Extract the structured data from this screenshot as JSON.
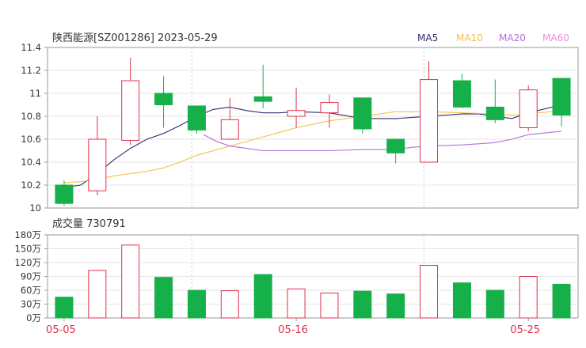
{
  "chart_data": [
    {
      "type": "candlestick",
      "title": "陕西能源[SZ001286] 2023-05-29",
      "legend": [
        {
          "label": "MA5",
          "color": "#2e2e6e"
        },
        {
          "label": "MA10",
          "color": "#f5c04a"
        },
        {
          "label": "MA20",
          "color": "#b070d8"
        },
        {
          "label": "MA60",
          "color": "#e890d8"
        }
      ],
      "y_ticks": [
        "11.4",
        "11.2",
        "11",
        "10.8",
        "10.6",
        "10.4",
        "10.2",
        "10"
      ],
      "ylim": [
        10.0,
        11.4
      ],
      "x_ticks": [
        {
          "index": 0,
          "label": "05-05"
        },
        {
          "index": 7,
          "label": "05-16"
        },
        {
          "index": 14,
          "label": "05-25"
        }
      ],
      "candles": [
        {
          "o": 10.2,
          "h": 10.24,
          "l": 10.02,
          "c": 10.04
        },
        {
          "o": 10.15,
          "h": 10.8,
          "l": 10.11,
          "c": 10.6
        },
        {
          "o": 10.59,
          "h": 11.31,
          "l": 10.55,
          "c": 11.11
        },
        {
          "o": 11.0,
          "h": 11.15,
          "l": 10.7,
          "c": 10.9
        },
        {
          "o": 10.89,
          "h": 10.89,
          "l": 10.65,
          "c": 10.68
        },
        {
          "o": 10.6,
          "h": 10.96,
          "l": 10.6,
          "c": 10.77
        },
        {
          "o": 10.97,
          "h": 11.25,
          "l": 10.87,
          "c": 10.93
        },
        {
          "o": 10.8,
          "h": 11.05,
          "l": 10.7,
          "c": 10.85
        },
        {
          "o": 10.83,
          "h": 10.99,
          "l": 10.7,
          "c": 10.92
        },
        {
          "o": 10.96,
          "h": 10.96,
          "l": 10.65,
          "c": 10.69
        },
        {
          "o": 10.6,
          "h": 10.6,
          "l": 10.39,
          "c": 10.48
        },
        {
          "o": 10.4,
          "h": 11.28,
          "l": 10.4,
          "c": 11.12
        },
        {
          "o": 11.11,
          "h": 11.17,
          "l": 10.87,
          "c": 10.88
        },
        {
          "o": 10.88,
          "h": 11.12,
          "l": 10.74,
          "c": 10.77
        },
        {
          "o": 10.7,
          "h": 11.07,
          "l": 10.67,
          "c": 11.03
        },
        {
          "o": 11.13,
          "h": 11.13,
          "l": 10.71,
          "c": 10.81
        }
      ],
      "ma_lines": {
        "MA5": [
          10.18,
          10.2,
          10.3,
          10.42,
          10.52,
          10.6,
          10.65,
          10.72,
          10.8,
          10.86,
          10.88,
          10.85,
          10.83,
          10.83,
          10.84,
          10.83,
          10.78,
          10.78,
          10.8,
          10.82,
          10.82,
          10.8,
          10.78,
          10.83,
          10.9,
          10.92
        ],
        "MA10": [
          10.22,
          10.23,
          10.25,
          10.28,
          10.3,
          10.32,
          10.35,
          10.4,
          10.46,
          10.5,
          10.54,
          10.58,
          10.62,
          10.66,
          10.7,
          10.73,
          10.76,
          10.8,
          10.84,
          10.84,
          10.83,
          10.82,
          10.81,
          10.82,
          10.85,
          10.85
        ],
        "MA20": [
          10.64,
          10.58,
          10.54,
          10.52,
          10.5,
          10.5,
          10.5,
          10.5,
          10.51,
          10.51,
          10.53,
          10.54,
          10.55,
          10.56,
          10.57,
          10.6,
          10.64,
          10.67
        ],
        "MA60": []
      },
      "ma_x": {
        "MA5": [
          0,
          0.5,
          1,
          1.5,
          2,
          2.5,
          3,
          3.5,
          4,
          4.5,
          5,
          5.5,
          6,
          6.5,
          7,
          8,
          9,
          10,
          11,
          12,
          12.5,
          13,
          13.5,
          14,
          15,
          15.1
        ],
        "MA10": [
          0,
          0.5,
          1,
          1.5,
          2,
          2.5,
          3,
          3.5,
          4,
          4.5,
          5,
          5.5,
          6,
          6.5,
          7,
          7.5,
          8,
          9,
          10,
          11,
          12,
          13,
          13.5,
          14,
          15,
          15.1
        ],
        "MA20": [
          4.2,
          4.6,
          5,
          5.5,
          6,
          6.5,
          7,
          8,
          9,
          10,
          10.5,
          11,
          12,
          12.5,
          13,
          13.5,
          14,
          15
        ]
      }
    },
    {
      "type": "bar",
      "title": "成交量 730791",
      "unit": "万",
      "y_ticks": [
        "180万",
        "150万",
        "120万",
        "90万",
        "60万",
        "30万",
        "0万"
      ],
      "ylim": [
        0,
        180
      ],
      "values": [
        45,
        103,
        158,
        88,
        60,
        59,
        94,
        63,
        54,
        58,
        52,
        114,
        76,
        60,
        90,
        73
      ],
      "direction": [
        "down",
        "up",
        "up",
        "down",
        "down",
        "up",
        "down",
        "up",
        "up",
        "down",
        "down",
        "up",
        "down",
        "down",
        "up",
        "down"
      ],
      "colors": {
        "up": "#e0304a",
        "down": "#16b04a"
      }
    }
  ]
}
